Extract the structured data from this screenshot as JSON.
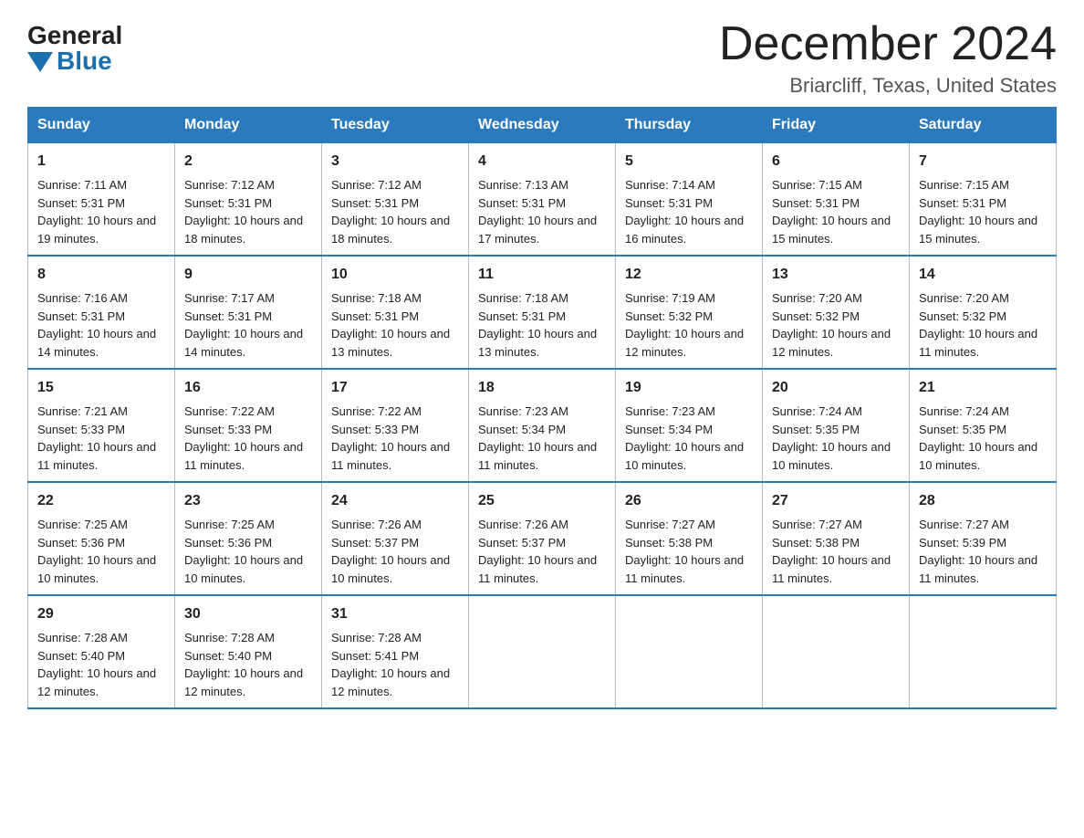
{
  "logo": {
    "general": "General",
    "blue": "Blue"
  },
  "title": "December 2024",
  "subtitle": "Briarcliff, Texas, United States",
  "days_of_week": [
    "Sunday",
    "Monday",
    "Tuesday",
    "Wednesday",
    "Thursday",
    "Friday",
    "Saturday"
  ],
  "weeks": [
    [
      {
        "day": "1",
        "sunrise": "7:11 AM",
        "sunset": "5:31 PM",
        "daylight": "10 hours and 19 minutes."
      },
      {
        "day": "2",
        "sunrise": "7:12 AM",
        "sunset": "5:31 PM",
        "daylight": "10 hours and 18 minutes."
      },
      {
        "day": "3",
        "sunrise": "7:12 AM",
        "sunset": "5:31 PM",
        "daylight": "10 hours and 18 minutes."
      },
      {
        "day": "4",
        "sunrise": "7:13 AM",
        "sunset": "5:31 PM",
        "daylight": "10 hours and 17 minutes."
      },
      {
        "day": "5",
        "sunrise": "7:14 AM",
        "sunset": "5:31 PM",
        "daylight": "10 hours and 16 minutes."
      },
      {
        "day": "6",
        "sunrise": "7:15 AM",
        "sunset": "5:31 PM",
        "daylight": "10 hours and 15 minutes."
      },
      {
        "day": "7",
        "sunrise": "7:15 AM",
        "sunset": "5:31 PM",
        "daylight": "10 hours and 15 minutes."
      }
    ],
    [
      {
        "day": "8",
        "sunrise": "7:16 AM",
        "sunset": "5:31 PM",
        "daylight": "10 hours and 14 minutes."
      },
      {
        "day": "9",
        "sunrise": "7:17 AM",
        "sunset": "5:31 PM",
        "daylight": "10 hours and 14 minutes."
      },
      {
        "day": "10",
        "sunrise": "7:18 AM",
        "sunset": "5:31 PM",
        "daylight": "10 hours and 13 minutes."
      },
      {
        "day": "11",
        "sunrise": "7:18 AM",
        "sunset": "5:31 PM",
        "daylight": "10 hours and 13 minutes."
      },
      {
        "day": "12",
        "sunrise": "7:19 AM",
        "sunset": "5:32 PM",
        "daylight": "10 hours and 12 minutes."
      },
      {
        "day": "13",
        "sunrise": "7:20 AM",
        "sunset": "5:32 PM",
        "daylight": "10 hours and 12 minutes."
      },
      {
        "day": "14",
        "sunrise": "7:20 AM",
        "sunset": "5:32 PM",
        "daylight": "10 hours and 11 minutes."
      }
    ],
    [
      {
        "day": "15",
        "sunrise": "7:21 AM",
        "sunset": "5:33 PM",
        "daylight": "10 hours and 11 minutes."
      },
      {
        "day": "16",
        "sunrise": "7:22 AM",
        "sunset": "5:33 PM",
        "daylight": "10 hours and 11 minutes."
      },
      {
        "day": "17",
        "sunrise": "7:22 AM",
        "sunset": "5:33 PM",
        "daylight": "10 hours and 11 minutes."
      },
      {
        "day": "18",
        "sunrise": "7:23 AM",
        "sunset": "5:34 PM",
        "daylight": "10 hours and 11 minutes."
      },
      {
        "day": "19",
        "sunrise": "7:23 AM",
        "sunset": "5:34 PM",
        "daylight": "10 hours and 10 minutes."
      },
      {
        "day": "20",
        "sunrise": "7:24 AM",
        "sunset": "5:35 PM",
        "daylight": "10 hours and 10 minutes."
      },
      {
        "day": "21",
        "sunrise": "7:24 AM",
        "sunset": "5:35 PM",
        "daylight": "10 hours and 10 minutes."
      }
    ],
    [
      {
        "day": "22",
        "sunrise": "7:25 AM",
        "sunset": "5:36 PM",
        "daylight": "10 hours and 10 minutes."
      },
      {
        "day": "23",
        "sunrise": "7:25 AM",
        "sunset": "5:36 PM",
        "daylight": "10 hours and 10 minutes."
      },
      {
        "day": "24",
        "sunrise": "7:26 AM",
        "sunset": "5:37 PM",
        "daylight": "10 hours and 10 minutes."
      },
      {
        "day": "25",
        "sunrise": "7:26 AM",
        "sunset": "5:37 PM",
        "daylight": "10 hours and 11 minutes."
      },
      {
        "day": "26",
        "sunrise": "7:27 AM",
        "sunset": "5:38 PM",
        "daylight": "10 hours and 11 minutes."
      },
      {
        "day": "27",
        "sunrise": "7:27 AM",
        "sunset": "5:38 PM",
        "daylight": "10 hours and 11 minutes."
      },
      {
        "day": "28",
        "sunrise": "7:27 AM",
        "sunset": "5:39 PM",
        "daylight": "10 hours and 11 minutes."
      }
    ],
    [
      {
        "day": "29",
        "sunrise": "7:28 AM",
        "sunset": "5:40 PM",
        "daylight": "10 hours and 12 minutes."
      },
      {
        "day": "30",
        "sunrise": "7:28 AM",
        "sunset": "5:40 PM",
        "daylight": "10 hours and 12 minutes."
      },
      {
        "day": "31",
        "sunrise": "7:28 AM",
        "sunset": "5:41 PM",
        "daylight": "10 hours and 12 minutes."
      },
      null,
      null,
      null,
      null
    ]
  ],
  "labels": {
    "sunrise_prefix": "Sunrise: ",
    "sunset_prefix": "Sunset: ",
    "daylight_prefix": "Daylight: "
  }
}
